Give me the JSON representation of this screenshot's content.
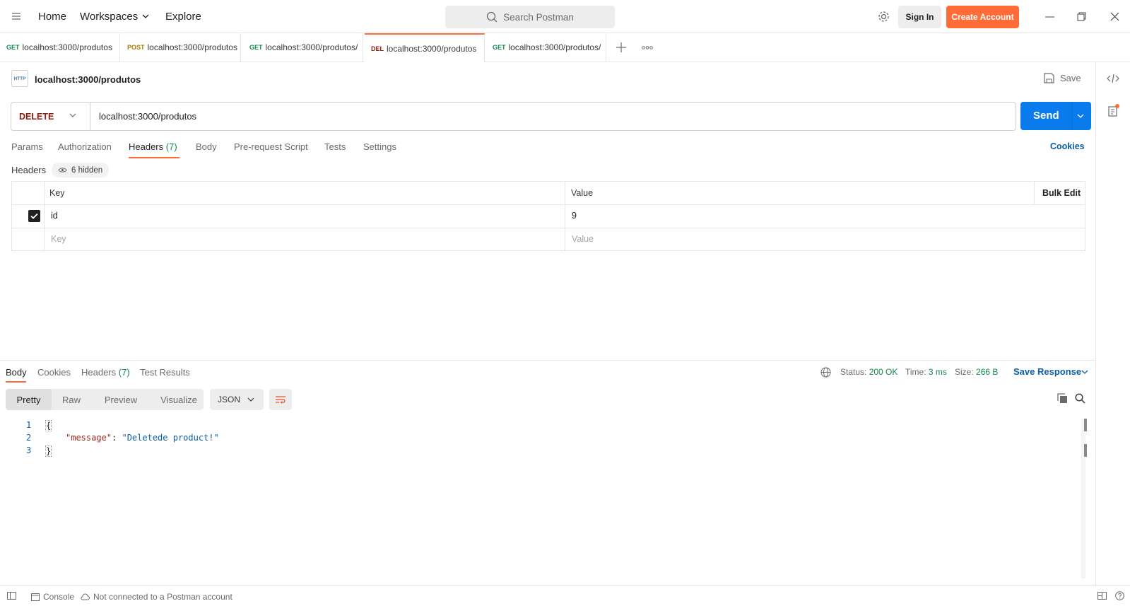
{
  "topnav": {
    "home": "Home",
    "workspaces": "Workspaces",
    "explore": "Explore",
    "search_placeholder": "Search Postman",
    "sign_in": "Sign In",
    "create_account": "Create Account"
  },
  "tabs": [
    {
      "method": "GET",
      "url": "localhost:3000/produtos",
      "color": "#0f8a4a"
    },
    {
      "method": "POST",
      "url": "localhost:3000/produtos",
      "color": "#ad7a03"
    },
    {
      "method": "GET",
      "url": "localhost:3000/produtos/",
      "color": "#0f8a4a"
    },
    {
      "method": "DEL",
      "url": "localhost:3000/produtos",
      "color": "#8e1a10",
      "active": true
    },
    {
      "method": "GET",
      "url": "localhost:3000/produtos/",
      "color": "#0f8a4a"
    }
  ],
  "request": {
    "icon_label": "HTTP",
    "title": "localhost:3000/produtos",
    "save": "Save",
    "method": "DELETE",
    "url": "localhost:3000/produtos",
    "send": "Send"
  },
  "subtabs": {
    "params": "Params",
    "authorization": "Authorization",
    "headers": "Headers",
    "headers_count": "(7)",
    "body": "Body",
    "prerequest": "Pre-request Script",
    "tests": "Tests",
    "settings": "Settings",
    "cookies": "Cookies"
  },
  "headers_section": {
    "label": "Headers",
    "hidden": "6 hidden",
    "col_key": "Key",
    "col_value": "Value",
    "bulk_edit": "Bulk Edit",
    "rows": [
      {
        "key": "id",
        "value": "9",
        "checked": true
      }
    ],
    "key_placeholder": "Key",
    "value_placeholder": "Value"
  },
  "response": {
    "tabs": {
      "body": "Body",
      "cookies": "Cookies",
      "headers": "Headers",
      "headers_count": "(7)",
      "test_results": "Test Results"
    },
    "status_label": "Status:",
    "status_value": "200 OK",
    "time_label": "Time:",
    "time_value": "3 ms",
    "size_label": "Size:",
    "size_value": "266 B",
    "save_response": "Save Response",
    "views": {
      "pretty": "Pretty",
      "raw": "Raw",
      "preview": "Preview",
      "visualize": "Visualize"
    },
    "format": "JSON",
    "code_lines": [
      {
        "n": "1",
        "text": "{"
      },
      {
        "n": "2",
        "key": "\"message\"",
        "sep": ": ",
        "val": "\"Deletede product!\""
      },
      {
        "n": "3",
        "text": "}"
      }
    ]
  },
  "footer": {
    "console": "Console",
    "not_connected": "Not connected to a Postman account"
  },
  "colors": {
    "accent": "#ff6c37",
    "send": "#097bed",
    "delete": "#8e1a10",
    "get": "#0f8a4a",
    "post": "#ad7a03"
  }
}
